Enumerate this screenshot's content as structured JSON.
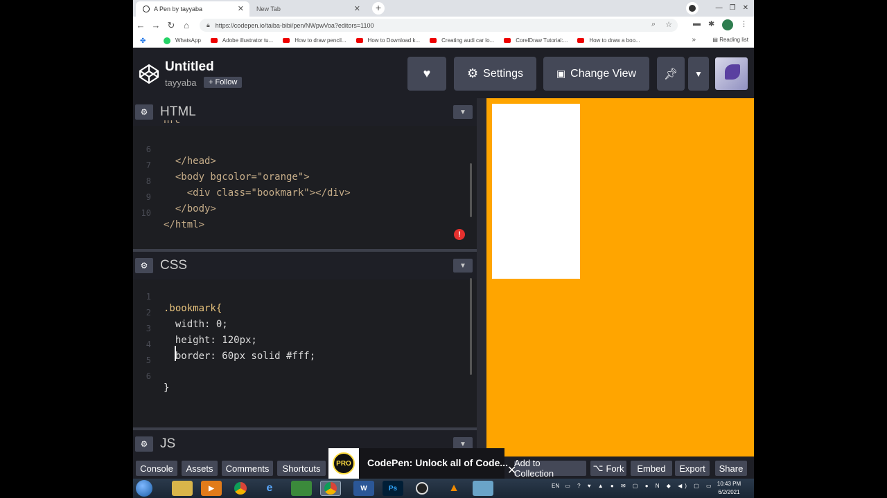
{
  "browser": {
    "tabs": [
      {
        "label": "A Pen by tayyaba",
        "active": true
      },
      {
        "label": "New Tab",
        "active": false
      }
    ],
    "url": "https://codepen.io/taiba-bibi/pen/NWpwVoa?editors=1100",
    "bookmarks": [
      {
        "label": "WhatsApp",
        "icon": "whatsapp-icon"
      },
      {
        "label": "Adobe illustrator tu...",
        "icon": "youtube-icon"
      },
      {
        "label": "How to draw pencil...",
        "icon": "youtube-icon"
      },
      {
        "label": "How to Download k...",
        "icon": "youtube-icon"
      },
      {
        "label": "Creating audi car lo...",
        "icon": "youtube-icon"
      },
      {
        "label": "CorelDraw Tutorial:...",
        "icon": "youtube-icon"
      },
      {
        "label": "How to draw a boo...",
        "icon": "youtube-icon"
      }
    ],
    "overflow": "»",
    "reading_list": "Reading list"
  },
  "codepen": {
    "title": "Untitled",
    "author": "tayyaba",
    "follow_label": "+ Follow",
    "settings_label": "Settings",
    "change_view_label": "Change View"
  },
  "html_panel": {
    "title": "HTML",
    "lines": [
      {
        "n": "",
        "code": "href=\"css/style.css\">"
      },
      {
        "n": "6",
        "code": "  </head>"
      },
      {
        "n": "7",
        "code": "  <body bgcolor=\"orange\">"
      },
      {
        "n": "8",
        "code": "    <div class=\"bookmark\"></div>"
      },
      {
        "n": "9",
        "code": "  </body>"
      },
      {
        "n": "10",
        "code": "</html>"
      }
    ]
  },
  "css_panel": {
    "title": "CSS",
    "lines": [
      {
        "n": "1",
        "code": ".bookmark{"
      },
      {
        "n": "2",
        "code": "  width: 0;"
      },
      {
        "n": "3",
        "code": "  height: 120px;"
      },
      {
        "n": "4",
        "code": "  border: 60px solid #fff;"
      },
      {
        "n": "5",
        "code": "  "
      },
      {
        "n": "6",
        "code": "}"
      }
    ]
  },
  "js_panel": {
    "title": "JS"
  },
  "footer": {
    "console": "Console",
    "assets": "Assets",
    "comments": "Comments",
    "shortcuts": "Shortcuts",
    "add_to_collection": "Add to Collection",
    "fork": "Fork",
    "embed": "Embed",
    "export": "Export",
    "share": "Share"
  },
  "promo": {
    "badge": "PRO",
    "text": "CodePen: Unlock all of Code..."
  },
  "taskbar": {
    "language": "EN",
    "time": "10:43 PM",
    "date": "6/2/2021"
  },
  "colors": {
    "preview_bg": "#ffa500",
    "bookmark_fill": "#ffffff",
    "editor_bg": "#1d1e22",
    "button_bg": "#444857"
  }
}
